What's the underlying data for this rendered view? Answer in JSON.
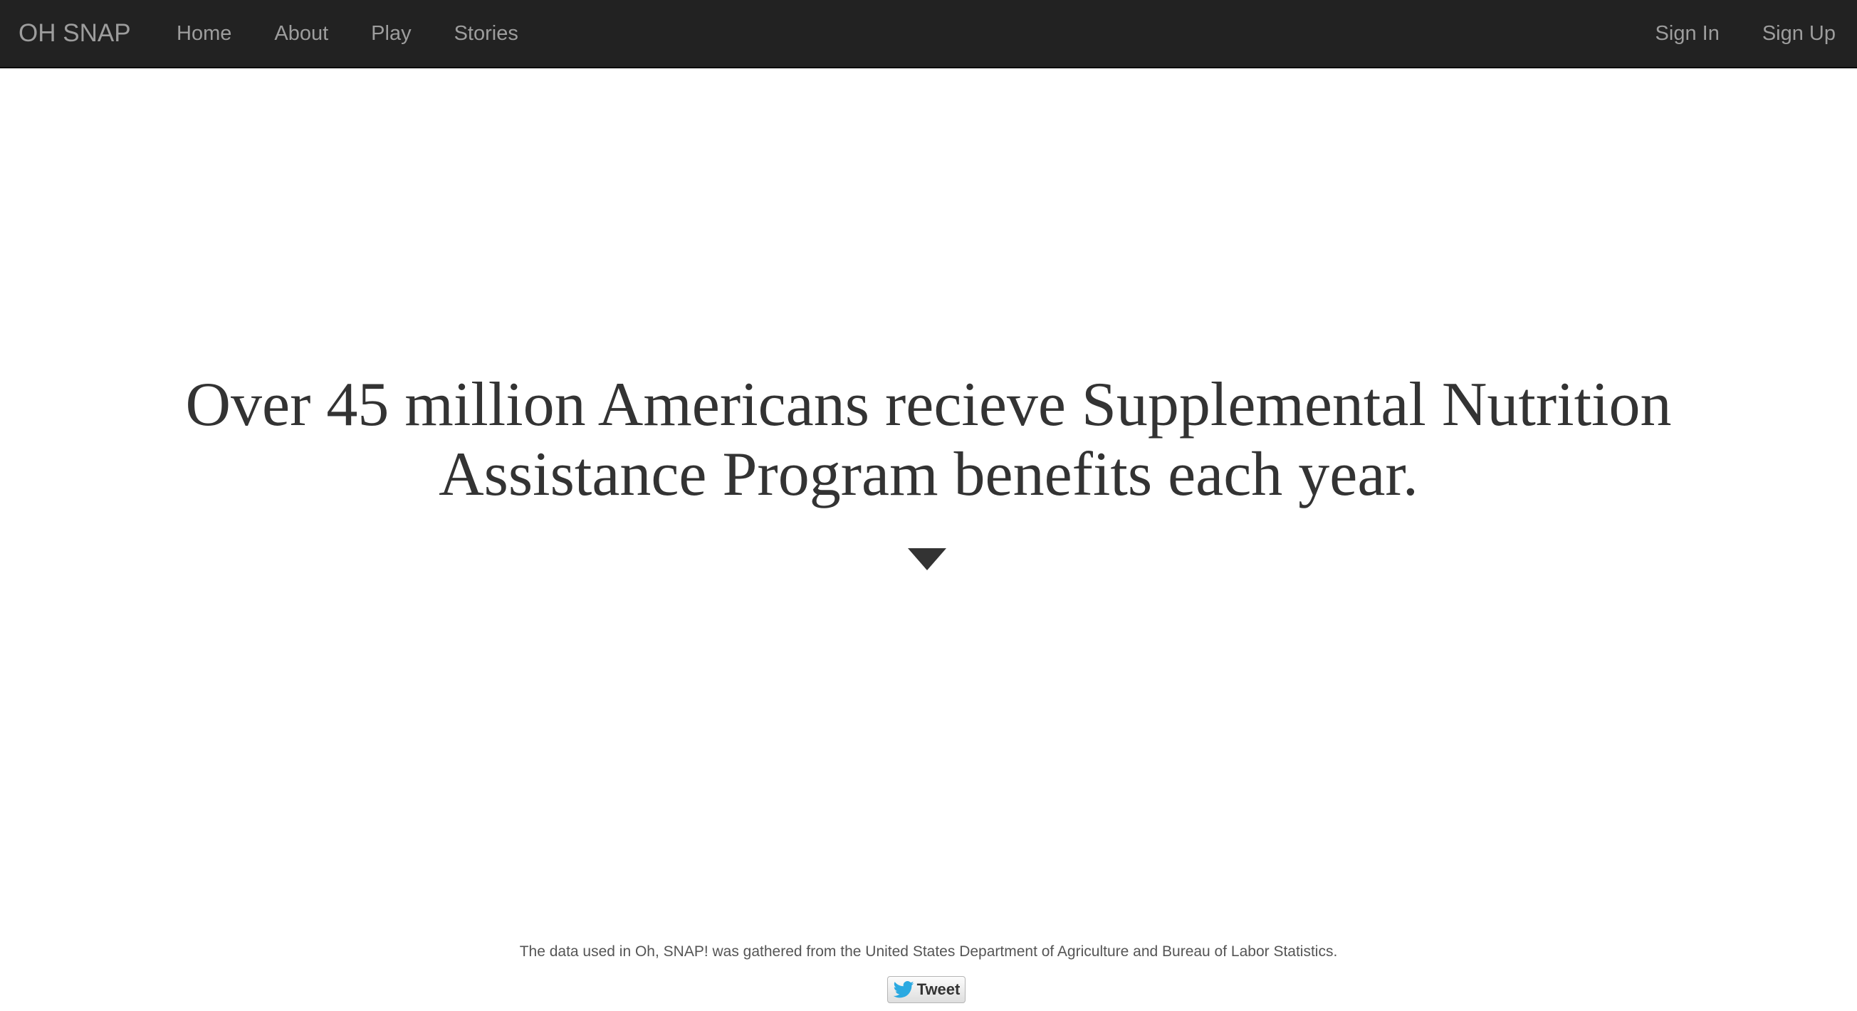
{
  "navbar": {
    "brand": "OH SNAP",
    "left_links": [
      "Home",
      "About",
      "Play",
      "Stories"
    ],
    "right_links": [
      "Sign In",
      "Sign Up"
    ]
  },
  "hero": {
    "headline": "Over 45 million Americans recieve Supplemental Nutrition Assistance Program benefits each year.",
    "scroll_icon": "caret-down-icon"
  },
  "footer": {
    "note": "The data used in Oh, SNAP! was gathered from the United States Department of Agriculture and Bureau of Labor Statistics.",
    "tweet_label": "Tweet",
    "tweet_icon": "twitter-bird-icon"
  },
  "colors": {
    "navbar_bg": "#222222",
    "nav_text": "#9d9d9d",
    "headline_text": "#333333",
    "twitter_blue": "#2ba9e1"
  }
}
